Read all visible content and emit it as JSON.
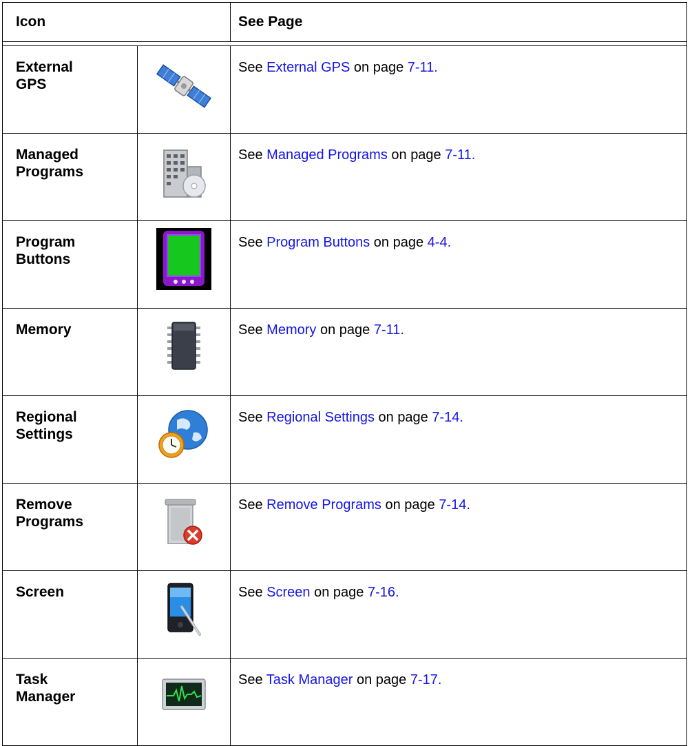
{
  "header": {
    "icon": "Icon",
    "see_page": "See Page"
  },
  "rows": [
    {
      "name": "External\nGPS",
      "icon": "satellite-icon",
      "prefix": "See ",
      "link": "External GPS",
      "mid": " on page ",
      "page": "7-11."
    },
    {
      "name": "Managed\nPrograms",
      "icon": "building-disc-icon",
      "prefix": "See ",
      "link": "Managed Programs",
      "mid": " on page ",
      "page": "7-11."
    },
    {
      "name": "Program\nButtons",
      "icon": "program-buttons-icon",
      "prefix": "See ",
      "link": "Program Buttons",
      "mid": " on page ",
      "page": "4-4."
    },
    {
      "name": "Memory",
      "icon": "memory-chip-icon",
      "prefix": "See ",
      "link": "Memory",
      "mid": " on page ",
      "page": "7-11."
    },
    {
      "name": "Regional\nSettings",
      "icon": "globe-clock-icon",
      "prefix": "See ",
      "link": "Regional Settings",
      "mid": " on page ",
      "page": "7-14."
    },
    {
      "name": "Remove\nPrograms",
      "icon": "remove-programs-icon",
      "prefix": "See ",
      "link": "Remove Programs",
      "mid": " on page ",
      "page": "7-14."
    },
    {
      "name": "Screen",
      "icon": "screen-stylus-icon",
      "prefix": "See ",
      "link": "Screen",
      "mid": " on page ",
      "page": "7-16."
    },
    {
      "name": "Task\nManager",
      "icon": "task-manager-icon",
      "prefix": "See ",
      "link": "Task Manager",
      "mid": " on page ",
      "page": "7-17."
    }
  ]
}
